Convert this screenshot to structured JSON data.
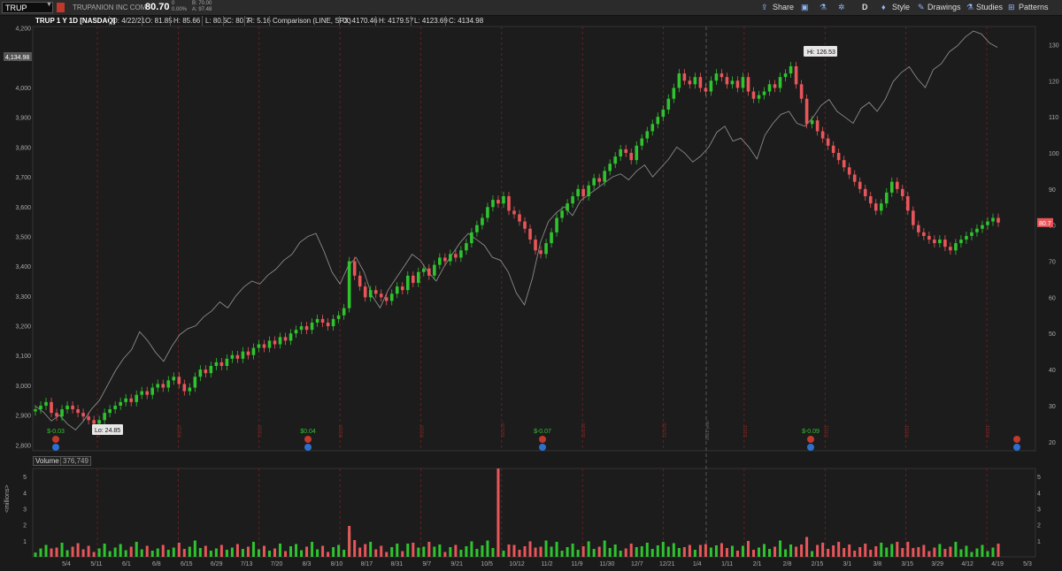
{
  "toolbar": {
    "symbol": "TRUP",
    "company": "TRUPANION INC COM",
    "last": "80.70",
    "change_line1": "0",
    "change_line2": "0.00%",
    "bid": "B: 70.00",
    "ask": "A: 97.48",
    "share": "Share",
    "period": "D",
    "style": "Style",
    "drawings": "Drawings",
    "studies": "Studies",
    "patterns": "Patterns"
  },
  "info": {
    "title": "TRUP 1 Y 1D [NASDAQ]",
    "d": "D: 4/22/21",
    "o": "O: 81.85",
    "h": "H: 85.66",
    "l": "L: 80.5",
    "c": "C: 80.7",
    "r": "R: 5.16",
    "comparison": "Comparison (LINE, SPX)",
    "co": "O: 4170.46",
    "ch": "H: 4179.57",
    "cl": "L: 4123.69",
    "cc": "C: 4134.98"
  },
  "volume": {
    "label": "Volume",
    "value": "376,749"
  },
  "chart_data": {
    "type": "candlestick",
    "title": "TRUP 1 Y 1D [NASDAQ]",
    "left_axis": {
      "ticks": [
        "2,800",
        "2,900",
        "3,000",
        "3,100",
        "3,200",
        "3,300",
        "3,400",
        "3,500",
        "3,600",
        "3,700",
        "3,800",
        "3,900",
        "4,000",
        "4,100",
        "4,200"
      ],
      "range": [
        2780,
        4205
      ]
    },
    "right_axis": {
      "ticks": [
        "20",
        "30",
        "40",
        "50",
        "60",
        "70",
        "80",
        "90",
        "100",
        "110",
        "120",
        "130"
      ],
      "range": [
        17.5,
        135
      ]
    },
    "x_ticks": [
      "5/4",
      "5/11",
      "6/1",
      "6/8",
      "6/15",
      "6/29",
      "7/13",
      "7/20",
      "8/3",
      "8/10",
      "8/17",
      "8/31",
      "9/7",
      "9/21",
      "10/5",
      "10/12",
      "11/2",
      "11/9",
      "11/30",
      "12/7",
      "12/21",
      "1/4",
      "1/11",
      "2/1",
      "2/8",
      "2/15",
      "3/1",
      "3/8",
      "3/15",
      "3/29",
      "4/12",
      "4/19",
      "5/3"
    ],
    "year_marker": "2021 year",
    "month_markers": [
      "5/1/20",
      "6/1/20",
      "7/1/20",
      "8/1/20",
      "9/1/20",
      "10/1/20",
      "11/1/20",
      "12/1/20",
      "1/1/21",
      "2/1/21",
      "3/1/21",
      "4/1/21"
    ],
    "price_label": "80.7",
    "spx_label": "4,134.98",
    "annotations": {
      "hi": "Hi: 126.53",
      "lo": "Lo: 24.85"
    },
    "earnings": [
      "$-0.03",
      "$0.04",
      "$-0.07",
      "$-0.09"
    ],
    "volume_axis": {
      "label": "<millions>",
      "ticks": [
        "1",
        "2",
        "3",
        "4",
        "5"
      ],
      "range": [
        0,
        5.5
      ]
    },
    "series": [
      {
        "name": "TRUP",
        "closes": [
          29,
          30,
          31,
          28,
          27,
          29,
          30,
          29,
          28,
          27,
          26,
          25,
          26,
          28,
          29,
          30,
          31,
          32,
          31,
          33,
          34,
          33,
          35,
          36,
          35,
          37,
          38,
          36,
          34,
          35,
          38,
          40,
          39,
          41,
          42,
          41,
          43,
          44,
          43,
          45,
          44,
          46,
          47,
          46,
          48,
          47,
          49,
          48,
          50,
          51,
          52,
          51,
          53,
          54,
          53,
          52,
          54,
          55,
          57,
          70,
          66,
          63,
          60,
          62,
          61,
          60,
          59,
          61,
          63,
          62,
          66,
          64,
          67,
          68,
          66,
          69,
          71,
          70,
          72,
          71,
          73,
          75,
          78,
          80,
          82,
          85,
          87,
          86,
          88,
          84,
          83,
          81,
          79,
          76,
          73,
          72,
          75,
          78,
          82,
          84,
          86,
          88,
          90,
          88,
          91,
          93,
          92,
          95,
          97,
          99,
          101,
          100,
          98,
          102,
          104,
          106,
          108,
          110,
          112,
          115,
          118,
          122,
          120,
          119,
          121,
          118,
          117,
          120,
          122,
          121,
          119,
          120,
          118,
          121,
          117,
          115,
          116,
          117,
          119,
          118,
          121,
          122,
          124,
          119,
          115,
          108,
          109,
          106,
          104,
          102,
          100,
          98,
          96,
          94,
          92,
          90,
          88,
          86,
          84,
          86,
          89,
          92,
          90,
          88,
          84,
          80,
          78,
          77,
          76,
          75,
          76,
          74,
          73,
          75,
          76,
          77,
          78,
          79,
          80,
          81,
          82,
          80.7
        ]
      },
      {
        "name": "SPX",
        "values": [
          2930,
          2910,
          2880,
          2900,
          2870,
          2850,
          2880,
          2920,
          2950,
          3000,
          3050,
          3090,
          3120,
          3180,
          3150,
          3110,
          3080,
          3130,
          3170,
          3190,
          3200,
          3230,
          3250,
          3280,
          3260,
          3300,
          3330,
          3350,
          3340,
          3370,
          3390,
          3420,
          3440,
          3480,
          3500,
          3510,
          3450,
          3380,
          3340,
          3400,
          3430,
          3380,
          3300,
          3260,
          3320,
          3360,
          3400,
          3440,
          3420,
          3380,
          3350,
          3400,
          3440,
          3480,
          3510,
          3490,
          3470,
          3430,
          3420,
          3380,
          3310,
          3270,
          3360,
          3480,
          3550,
          3580,
          3600,
          3570,
          3620,
          3640,
          3660,
          3680,
          3700,
          3710,
          3690,
          3720,
          3740,
          3700,
          3730,
          3760,
          3800,
          3780,
          3750,
          3770,
          3800,
          3850,
          3870,
          3820,
          3830,
          3800,
          3760,
          3840,
          3880,
          3910,
          3920,
          3880,
          3870,
          3900,
          3940,
          3960,
          3920,
          3900,
          3880,
          3930,
          3950,
          3920,
          3960,
          4020,
          4050,
          4070,
          4030,
          4000,
          4060,
          4080,
          4120,
          4140,
          4170,
          4190,
          4180,
          4150,
          4134.98
        ]
      }
    ]
  }
}
